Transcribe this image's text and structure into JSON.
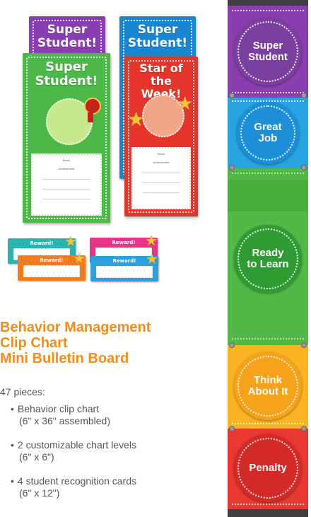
{
  "cards": {
    "purple_title": "Super Student!",
    "green_title": "Super Student!",
    "blue_title": "Super Student!",
    "red_title": "Star of the Week!",
    "form_name_label": "Name",
    "form_achievement_label": "Achievement"
  },
  "reward_cards": [
    {
      "label": "Reward!"
    },
    {
      "label": "Reward!"
    },
    {
      "label": "Reward!"
    },
    {
      "label": "Reward!"
    }
  ],
  "product": {
    "title_lines": [
      "Behavior Management",
      "Clip Chart",
      "Mini Bulletin Board"
    ],
    "pieces": "47 pieces:",
    "bullets": [
      {
        "main": "Behavior clip chart",
        "sub": "(6\" x 36\" assembled)"
      },
      {
        "main": "2 customizable chart levels",
        "sub": "(6\" x 6\")"
      },
      {
        "main": "4 student recognition cards",
        "sub": "(6\" x 12\")"
      }
    ]
  },
  "chart_levels": [
    {
      "label_1": "Super",
      "label_2": "Student",
      "color": "#7b3fa0"
    },
    {
      "label_1": "Great",
      "label_2": "Job",
      "color": "#1c8fd8"
    },
    {
      "label_1": "Ready",
      "label_2": "to Learn",
      "color": "#3da93d"
    },
    {
      "label_1": "Think",
      "label_2": "About It",
      "color": "#f7a21b"
    },
    {
      "label_1": "Penalty",
      "label_2": "",
      "color": "#e03131"
    }
  ],
  "colors": {
    "heading": "#f28c1b",
    "purple": "#8a3fb0",
    "green": "#4cb848",
    "blue": "#1a86d0",
    "red": "#e5352b",
    "teal": "#2bb3b1",
    "pink": "#e8358a",
    "orange": "#f47b20",
    "sky": "#2aa0dc"
  }
}
